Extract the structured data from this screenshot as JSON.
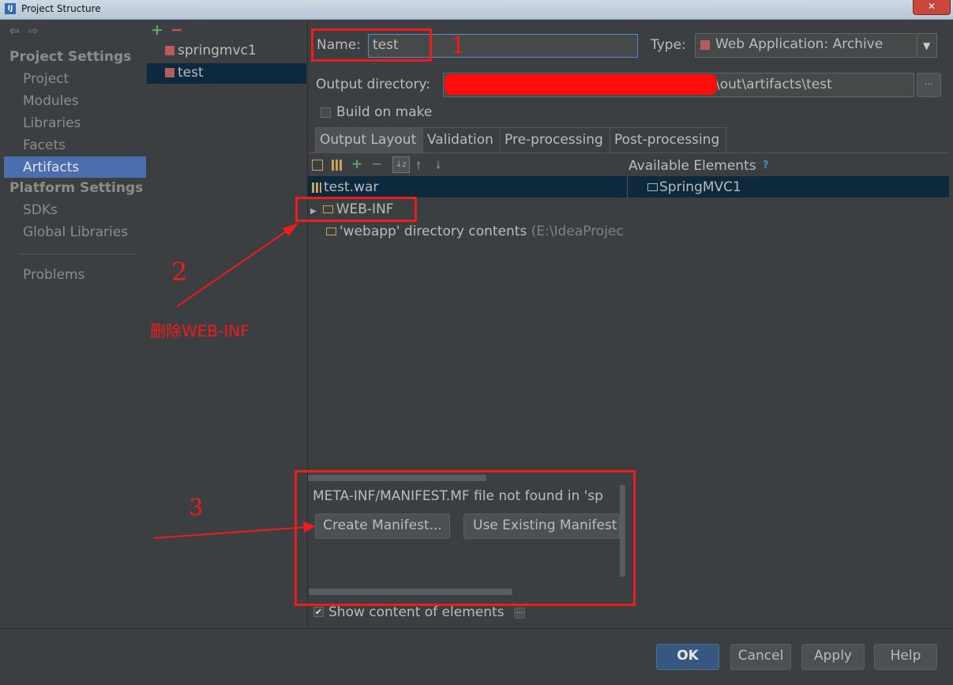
{
  "window": {
    "title": "Project Structure",
    "app_icon": "IJ",
    "close_glyph": "✕"
  },
  "nav": {
    "back_icon": "⇦",
    "forward_icon": "⇨"
  },
  "sidebar": {
    "project_settings": "Project Settings",
    "project_items": [
      "Project",
      "Modules",
      "Libraries",
      "Facets",
      "Artifacts"
    ],
    "platform_settings": "Platform Settings",
    "platform_items": [
      "SDKs",
      "Global Libraries"
    ],
    "problems": "Problems",
    "selected": "Artifacts"
  },
  "artifacts": {
    "add": "+",
    "remove": "−",
    "items": [
      "springmvc1",
      "test"
    ],
    "selected": "test"
  },
  "form": {
    "name_label": "Name:",
    "name_value": "test",
    "type_label": "Type:",
    "type_value": "Web Application: Archive",
    "output_label": "Output directory:",
    "output_value": "\\out\\artifacts\\test",
    "browse": "...",
    "build_on_make": "Build on make"
  },
  "tabs": [
    "Output Layout",
    "Validation",
    "Pre-processing",
    "Post-processing"
  ],
  "layout": {
    "available_label": "Available Elements",
    "help_mark": "?",
    "root": "test.war",
    "webinf": "WEB-INF",
    "webapp_prefix": "'webapp' directory contents",
    "webapp_path": " (E:\\IdeaProjec",
    "available_item": "SpringMVC1"
  },
  "manifest": {
    "message": "META-INF/MANIFEST.MF file not found in 'sp",
    "create": "Create Manifest...",
    "use_existing": "Use Existing Manifest"
  },
  "show_content": "Show content of elements",
  "buttons": {
    "ok": "OK",
    "cancel": "Cancel",
    "apply": "Apply",
    "help": "Help"
  },
  "annotations": {
    "one": "1",
    "two": "2",
    "three": "3",
    "delete_note": "删除WEB-INF"
  },
  "colors": {
    "annotation": "#ee1c1c",
    "selection": "#4b6eaf",
    "background": "#3c3f41"
  }
}
